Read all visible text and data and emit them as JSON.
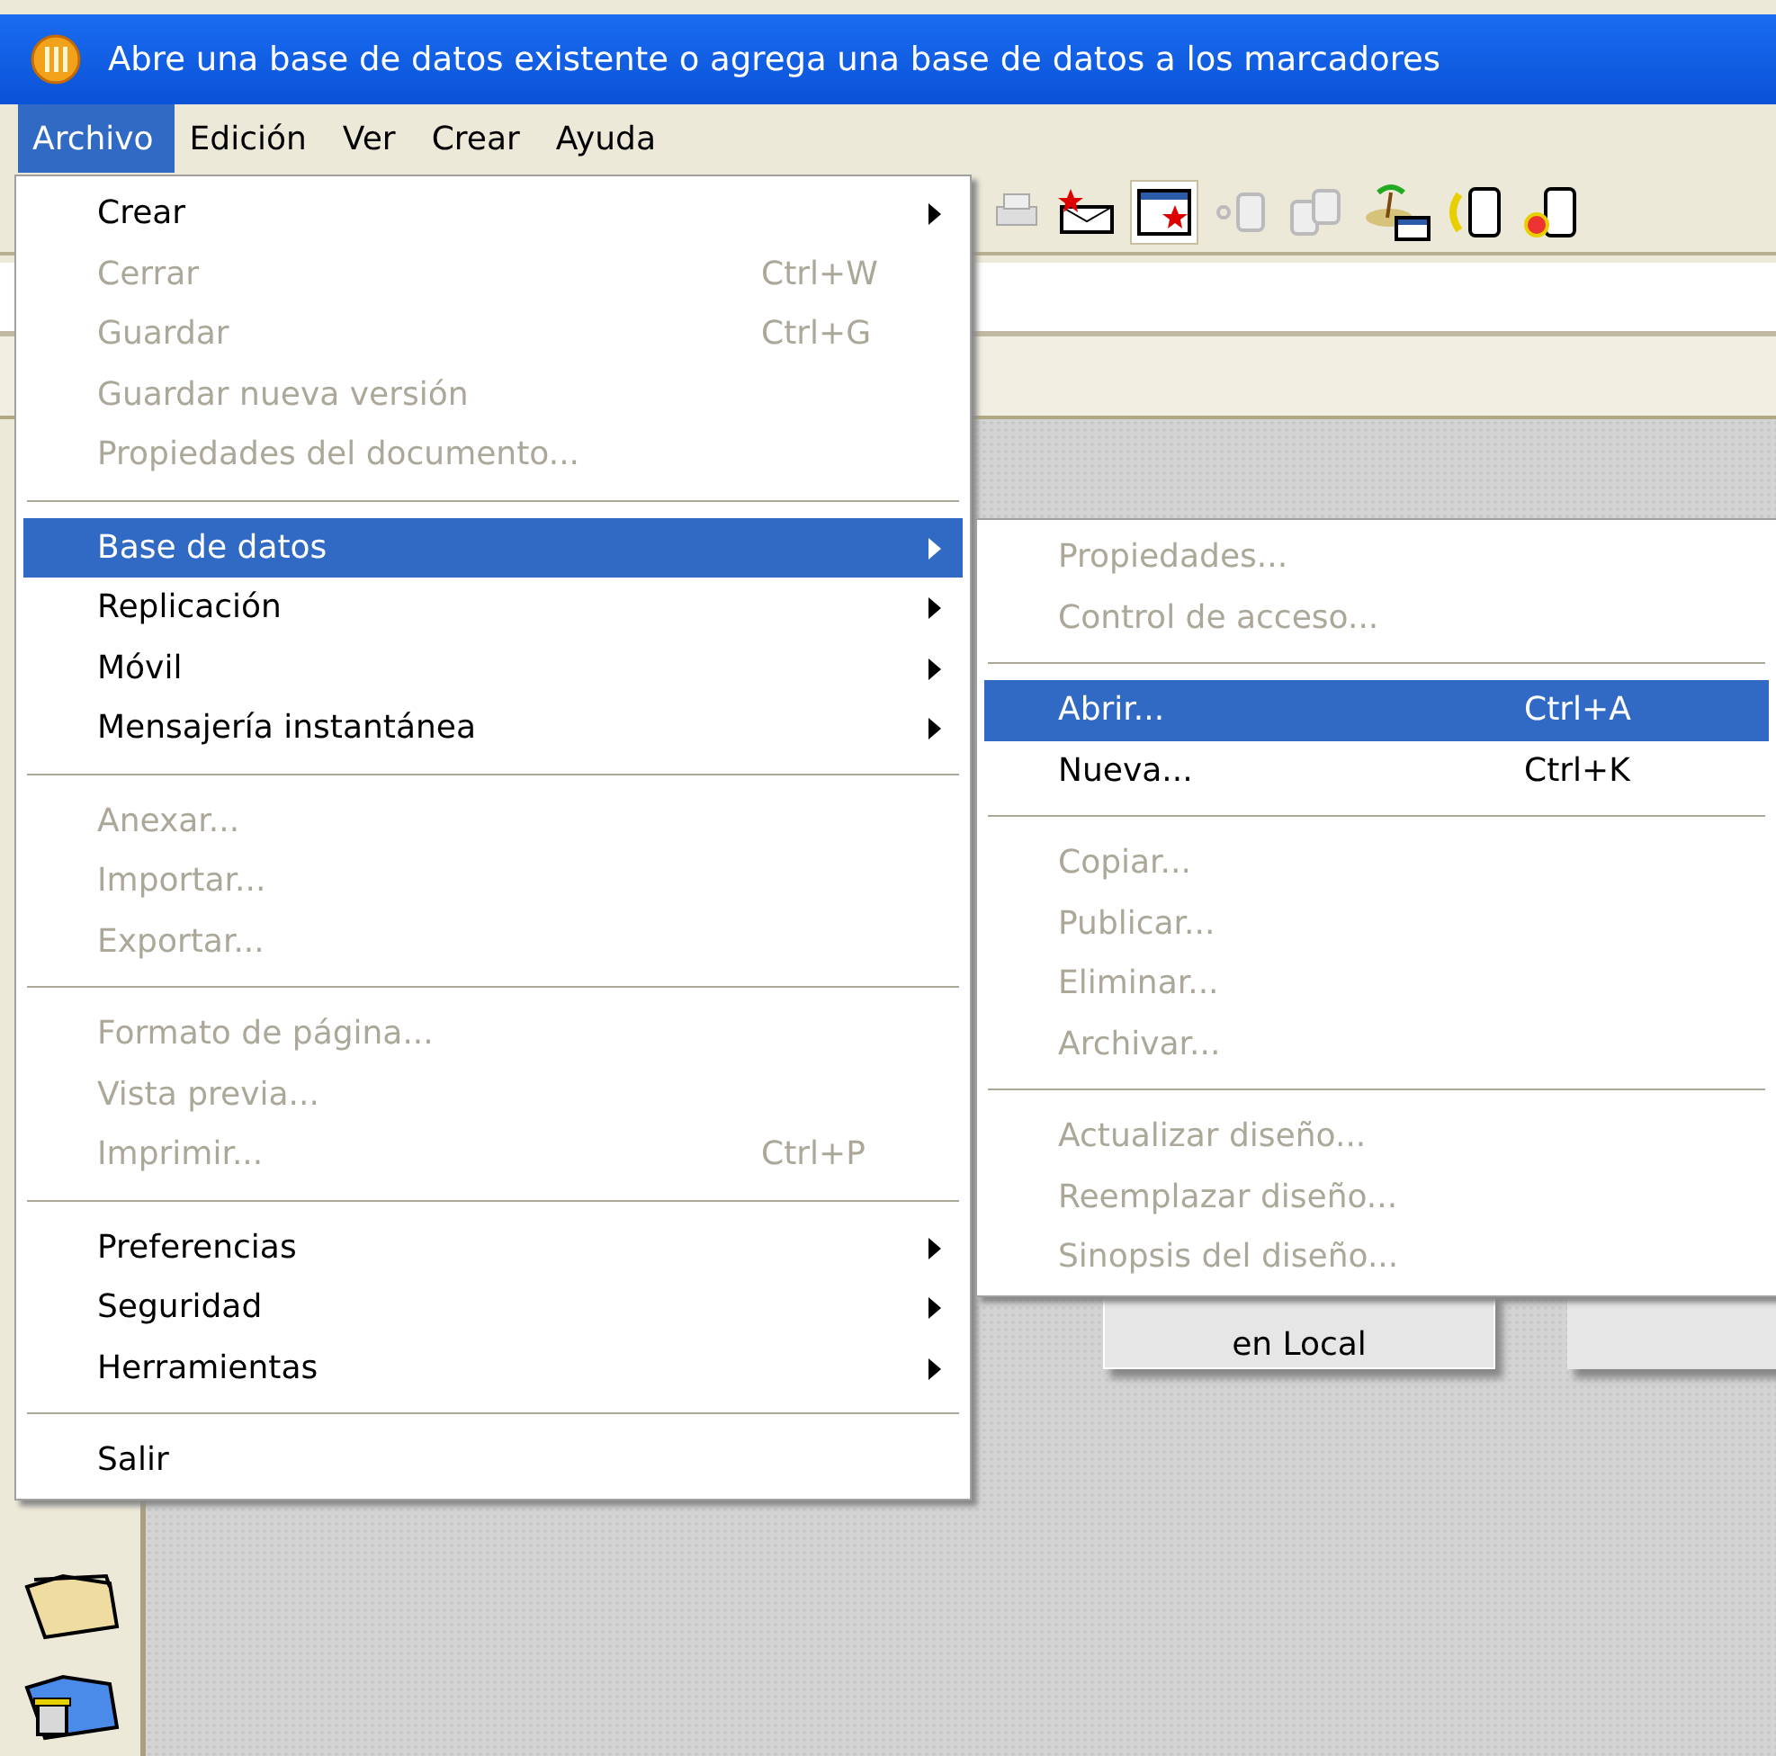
{
  "window": {
    "title": "Abre una base de datos existente o agrega una base de datos a los marcadores"
  },
  "menubar": [
    {
      "label": "Archivo",
      "selected": true
    },
    {
      "label": "Edición",
      "selected": false
    },
    {
      "label": "Ver",
      "selected": false
    },
    {
      "label": "Crear",
      "selected": false
    },
    {
      "label": "Ayuda",
      "selected": false
    }
  ],
  "file_menu": [
    {
      "kind": "item",
      "label": "Crear",
      "disabled": false,
      "selected": false,
      "submenu": true
    },
    {
      "kind": "item",
      "label": "Cerrar",
      "shortcut": "Ctrl+W",
      "disabled": true,
      "selected": false,
      "submenu": false
    },
    {
      "kind": "item",
      "label": "Guardar",
      "shortcut": "Ctrl+G",
      "disabled": true,
      "selected": false,
      "submenu": false
    },
    {
      "kind": "item",
      "label": "Guardar nueva versión",
      "disabled": true,
      "selected": false,
      "submenu": false
    },
    {
      "kind": "item",
      "label": "Propiedades del documento...",
      "disabled": true,
      "selected": false,
      "submenu": false
    },
    {
      "kind": "separator"
    },
    {
      "kind": "item",
      "label": "Base de datos",
      "disabled": false,
      "selected": true,
      "submenu": true
    },
    {
      "kind": "item",
      "label": "Replicación",
      "disabled": false,
      "selected": false,
      "submenu": true
    },
    {
      "kind": "item",
      "label": "Móvil",
      "disabled": false,
      "selected": false,
      "submenu": true
    },
    {
      "kind": "item",
      "label": "Mensajería instantánea",
      "disabled": false,
      "selected": false,
      "submenu": true
    },
    {
      "kind": "separator"
    },
    {
      "kind": "item",
      "label": "Anexar...",
      "disabled": true,
      "selected": false,
      "submenu": false
    },
    {
      "kind": "item",
      "label": "Importar...",
      "disabled": true,
      "selected": false,
      "submenu": false
    },
    {
      "kind": "item",
      "label": "Exportar...",
      "disabled": true,
      "selected": false,
      "submenu": false
    },
    {
      "kind": "separator"
    },
    {
      "kind": "item",
      "label": "Formato de página...",
      "disabled": true,
      "selected": false,
      "submenu": false
    },
    {
      "kind": "item",
      "label": "Vista previa...",
      "disabled": true,
      "selected": false,
      "submenu": false
    },
    {
      "kind": "item",
      "label": "Imprimir...",
      "shortcut": "Ctrl+P",
      "disabled": true,
      "selected": false,
      "submenu": false
    },
    {
      "kind": "separator"
    },
    {
      "kind": "item",
      "label": "Preferencias",
      "disabled": false,
      "selected": false,
      "submenu": true
    },
    {
      "kind": "item",
      "label": "Seguridad",
      "disabled": false,
      "selected": false,
      "submenu": true
    },
    {
      "kind": "item",
      "label": "Herramientas",
      "disabled": false,
      "selected": false,
      "submenu": true
    },
    {
      "kind": "separator"
    },
    {
      "kind": "item",
      "label": "Salir",
      "disabled": false,
      "selected": false,
      "submenu": false
    }
  ],
  "database_submenu": [
    {
      "kind": "item",
      "label": "Propiedades...",
      "disabled": true,
      "selected": false
    },
    {
      "kind": "item",
      "label": "Control de acceso...",
      "disabled": true,
      "selected": false
    },
    {
      "kind": "separator"
    },
    {
      "kind": "item",
      "label": "Abrir...",
      "shortcut": "Ctrl+A",
      "disabled": false,
      "selected": true
    },
    {
      "kind": "item",
      "label": "Nueva...",
      "shortcut": "Ctrl+K",
      "disabled": false,
      "selected": false
    },
    {
      "kind": "separator"
    },
    {
      "kind": "item",
      "label": "Copiar...",
      "disabled": true,
      "selected": false
    },
    {
      "kind": "item",
      "label": "Publicar...",
      "disabled": true,
      "selected": false
    },
    {
      "kind": "item",
      "label": "Eliminar...",
      "disabled": true,
      "selected": false
    },
    {
      "kind": "item",
      "label": "Archivar...",
      "disabled": true,
      "selected": false
    },
    {
      "kind": "separator"
    },
    {
      "kind": "item",
      "label": "Actualizar diseño...",
      "disabled": true,
      "selected": false
    },
    {
      "kind": "item",
      "label": "Reemplazar diseño...",
      "disabled": true,
      "selected": false
    },
    {
      "kind": "item",
      "label": "Sinopsis del diseño...",
      "disabled": true,
      "selected": false
    }
  ],
  "workspace": {
    "buttons": [
      "en Local"
    ]
  }
}
